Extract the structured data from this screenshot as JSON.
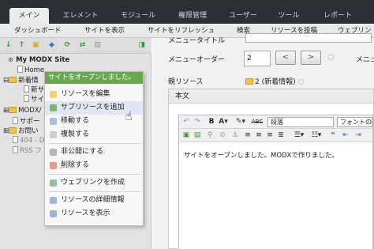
{
  "top_tabs": [
    "メイン",
    "エレメント",
    "モジュール",
    "権限管理",
    "ユーザー",
    "ツール",
    "レポート"
  ],
  "sub_tabs": [
    "ダッシュボード",
    "サイトを表示",
    "サイトをリフレッシュ",
    "検索",
    "リソースを投稿",
    "ウェブリン"
  ],
  "tree": {
    "site_name": "My MODX Site",
    "nodes": [
      "Home",
      "新着情",
      "新サ",
      "サイ",
      "MODX/",
      "サポー",
      "お問い",
      "404 - D",
      "RSS フ"
    ]
  },
  "context_menu": {
    "header": "サイトをオープンしました。",
    "items": [
      "リソースを編集",
      "サブリソースを追加",
      "移動する",
      "複製する",
      "非公開にする",
      "削除する",
      "ウェブリンクを作成",
      "リソースの詳細情報",
      "リソースを表示"
    ]
  },
  "form": {
    "menu_title_label": "メニュータイトル",
    "menu_order_label": "メニューオーダー",
    "menu_order_value": "2",
    "prev_button": "<",
    "next_button": ">",
    "right_label": "メニュー",
    "parent_label": "親リソース",
    "parent_value": "2 (新着情報)"
  },
  "editor": {
    "panel_title": "本文",
    "format_select": "段落",
    "font_size_select": "フォントの大きさ",
    "bold": "B",
    "abc": "ABC",
    "content": "サイトをオープンしました。MODXで作りました。"
  },
  "colors": {
    "topbar": "#2c3034",
    "menu_header": "#6aa84f",
    "folder": "#f1c24a"
  }
}
